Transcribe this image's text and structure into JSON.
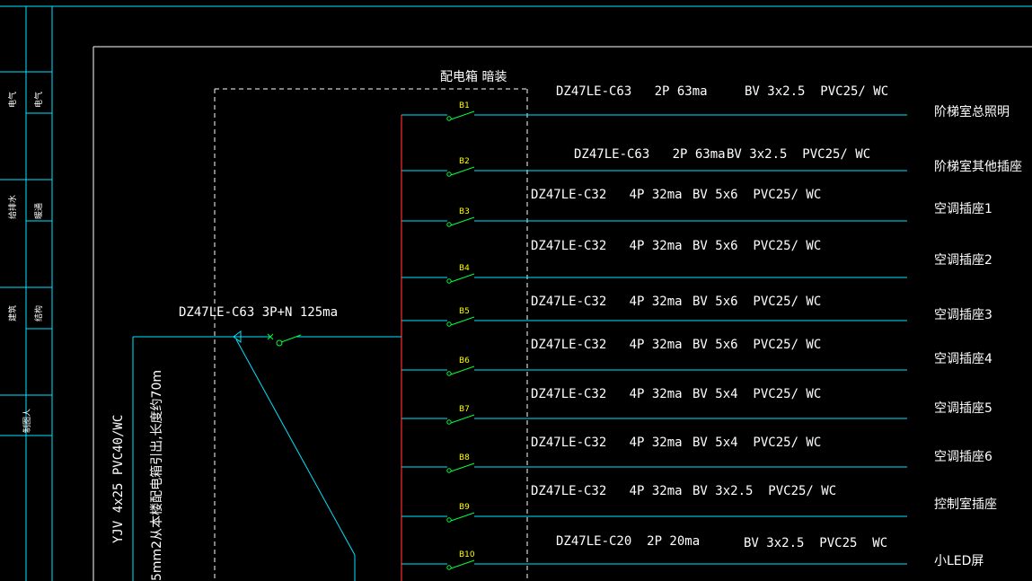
{
  "colors": {
    "background": "#000000",
    "frame": "#00e5ff",
    "border": "#ffffff",
    "busbar": "#ff2a2a",
    "feeder": "#00e5ff",
    "switch": "#00ff3c",
    "breaker_label": "#ffff00",
    "text": "#ffffff"
  },
  "title_block": {
    "labels": [
      "电气",
      "电气",
      "给排水",
      "暖通",
      "建筑",
      "结构",
      "制图人"
    ]
  },
  "panel": {
    "title": "配电箱 暗装",
    "main_breaker": "DZ47LE-C63 3P+N 125ma",
    "incoming_cable": "YJV 4x25    PVC40/WC",
    "incoming_note": "5mm2从本楼配电箱引出,长度约70m"
  },
  "circuits": [
    {
      "id": "B1",
      "breaker": "DZ47LE-C63   2P 63ma",
      "cable": "BV 3x2.5  PVC25/ WC",
      "load": "阶梯室总照明"
    },
    {
      "id": "B2",
      "breaker": "DZ47LE-C63   2P 63ma",
      "cable": "BV 3x2.5  PVC25/ WC",
      "load": "阶梯室其他插座"
    },
    {
      "id": "B3",
      "breaker": "DZ47LE-C32   4P 32ma",
      "cable": "BV 5x6  PVC25/ WC",
      "load": "空调插座1"
    },
    {
      "id": "B4",
      "breaker": "DZ47LE-C32   4P 32ma",
      "cable": "BV 5x6  PVC25/ WC",
      "load": "空调插座2"
    },
    {
      "id": "B5",
      "breaker": "DZ47LE-C32   4P 32ma",
      "cable": "BV 5x6  PVC25/ WC",
      "load": "空调插座3"
    },
    {
      "id": "B6",
      "breaker": "DZ47LE-C32   4P 32ma",
      "cable": "BV 5x6  PVC25/ WC",
      "load": "空调插座4"
    },
    {
      "id": "B7",
      "breaker": "DZ47LE-C32   4P 32ma",
      "cable": "BV 5x4  PVC25/ WC",
      "load": "空调插座5"
    },
    {
      "id": "B8",
      "breaker": "DZ47LE-C32   4P 32ma",
      "cable": "BV 5x4  PVC25/ WC",
      "load": "空调插座6"
    },
    {
      "id": "B9",
      "breaker": "DZ47LE-C32   4P 32ma",
      "cable": "BV 3x2.5  PVC25/ WC",
      "load": "控制室插座"
    },
    {
      "id": "B10",
      "breaker": "DZ47LE-C20  2P 20ma",
      "cable": "BV 3x2.5  PVC25  WC",
      "load": "小LED屏"
    }
  ]
}
